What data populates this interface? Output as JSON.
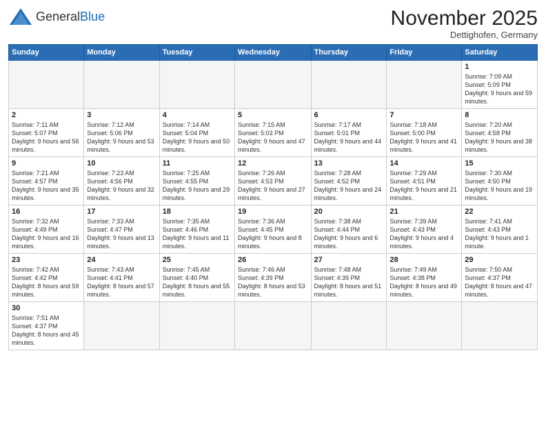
{
  "logo": {
    "general": "General",
    "blue": "Blue"
  },
  "header": {
    "month": "November 2025",
    "location": "Dettighofen, Germany"
  },
  "days_of_week": [
    "Sunday",
    "Monday",
    "Tuesday",
    "Wednesday",
    "Thursday",
    "Friday",
    "Saturday"
  ],
  "weeks": [
    [
      {
        "day": "",
        "info": ""
      },
      {
        "day": "",
        "info": ""
      },
      {
        "day": "",
        "info": ""
      },
      {
        "day": "",
        "info": ""
      },
      {
        "day": "",
        "info": ""
      },
      {
        "day": "",
        "info": ""
      },
      {
        "day": "1",
        "info": "Sunrise: 7:09 AM\nSunset: 5:09 PM\nDaylight: 9 hours and 59 minutes."
      }
    ],
    [
      {
        "day": "2",
        "info": "Sunrise: 7:11 AM\nSunset: 5:07 PM\nDaylight: 9 hours and 56 minutes."
      },
      {
        "day": "3",
        "info": "Sunrise: 7:12 AM\nSunset: 5:06 PM\nDaylight: 9 hours and 53 minutes."
      },
      {
        "day": "4",
        "info": "Sunrise: 7:14 AM\nSunset: 5:04 PM\nDaylight: 9 hours and 50 minutes."
      },
      {
        "day": "5",
        "info": "Sunrise: 7:15 AM\nSunset: 5:03 PM\nDaylight: 9 hours and 47 minutes."
      },
      {
        "day": "6",
        "info": "Sunrise: 7:17 AM\nSunset: 5:01 PM\nDaylight: 9 hours and 44 minutes."
      },
      {
        "day": "7",
        "info": "Sunrise: 7:18 AM\nSunset: 5:00 PM\nDaylight: 9 hours and 41 minutes."
      },
      {
        "day": "8",
        "info": "Sunrise: 7:20 AM\nSunset: 4:58 PM\nDaylight: 9 hours and 38 minutes."
      }
    ],
    [
      {
        "day": "9",
        "info": "Sunrise: 7:21 AM\nSunset: 4:57 PM\nDaylight: 9 hours and 35 minutes."
      },
      {
        "day": "10",
        "info": "Sunrise: 7:23 AM\nSunset: 4:56 PM\nDaylight: 9 hours and 32 minutes."
      },
      {
        "day": "11",
        "info": "Sunrise: 7:25 AM\nSunset: 4:55 PM\nDaylight: 9 hours and 29 minutes."
      },
      {
        "day": "12",
        "info": "Sunrise: 7:26 AM\nSunset: 4:53 PM\nDaylight: 9 hours and 27 minutes."
      },
      {
        "day": "13",
        "info": "Sunrise: 7:28 AM\nSunset: 4:52 PM\nDaylight: 9 hours and 24 minutes."
      },
      {
        "day": "14",
        "info": "Sunrise: 7:29 AM\nSunset: 4:51 PM\nDaylight: 9 hours and 21 minutes."
      },
      {
        "day": "15",
        "info": "Sunrise: 7:30 AM\nSunset: 4:50 PM\nDaylight: 9 hours and 19 minutes."
      }
    ],
    [
      {
        "day": "16",
        "info": "Sunrise: 7:32 AM\nSunset: 4:49 PM\nDaylight: 9 hours and 16 minutes."
      },
      {
        "day": "17",
        "info": "Sunrise: 7:33 AM\nSunset: 4:47 PM\nDaylight: 9 hours and 13 minutes."
      },
      {
        "day": "18",
        "info": "Sunrise: 7:35 AM\nSunset: 4:46 PM\nDaylight: 9 hours and 11 minutes."
      },
      {
        "day": "19",
        "info": "Sunrise: 7:36 AM\nSunset: 4:45 PM\nDaylight: 9 hours and 8 minutes."
      },
      {
        "day": "20",
        "info": "Sunrise: 7:38 AM\nSunset: 4:44 PM\nDaylight: 9 hours and 6 minutes."
      },
      {
        "day": "21",
        "info": "Sunrise: 7:39 AM\nSunset: 4:43 PM\nDaylight: 9 hours and 4 minutes."
      },
      {
        "day": "22",
        "info": "Sunrise: 7:41 AM\nSunset: 4:43 PM\nDaylight: 9 hours and 1 minute."
      }
    ],
    [
      {
        "day": "23",
        "info": "Sunrise: 7:42 AM\nSunset: 4:42 PM\nDaylight: 8 hours and 59 minutes."
      },
      {
        "day": "24",
        "info": "Sunrise: 7:43 AM\nSunset: 4:41 PM\nDaylight: 8 hours and 57 minutes."
      },
      {
        "day": "25",
        "info": "Sunrise: 7:45 AM\nSunset: 4:40 PM\nDaylight: 8 hours and 55 minutes."
      },
      {
        "day": "26",
        "info": "Sunrise: 7:46 AM\nSunset: 4:39 PM\nDaylight: 8 hours and 53 minutes."
      },
      {
        "day": "27",
        "info": "Sunrise: 7:48 AM\nSunset: 4:39 PM\nDaylight: 8 hours and 51 minutes."
      },
      {
        "day": "28",
        "info": "Sunrise: 7:49 AM\nSunset: 4:38 PM\nDaylight: 8 hours and 49 minutes."
      },
      {
        "day": "29",
        "info": "Sunrise: 7:50 AM\nSunset: 4:37 PM\nDaylight: 8 hours and 47 minutes."
      }
    ],
    [
      {
        "day": "30",
        "info": "Sunrise: 7:51 AM\nSunset: 4:37 PM\nDaylight: 8 hours and 45 minutes."
      },
      {
        "day": "",
        "info": ""
      },
      {
        "day": "",
        "info": ""
      },
      {
        "day": "",
        "info": ""
      },
      {
        "day": "",
        "info": ""
      },
      {
        "day": "",
        "info": ""
      },
      {
        "day": "",
        "info": ""
      }
    ]
  ]
}
